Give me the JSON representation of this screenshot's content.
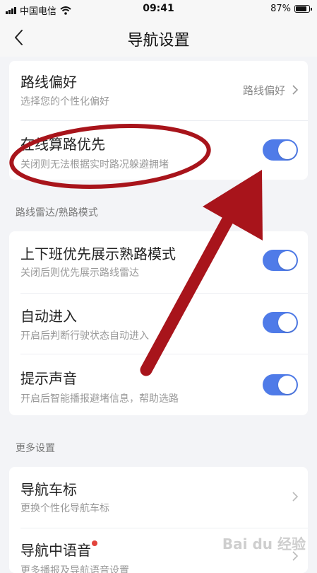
{
  "status_bar": {
    "carrier": "中国电信",
    "time": "09:41",
    "battery": "87%",
    "battery_level": 0.87
  },
  "nav": {
    "title": "导航设置"
  },
  "route_pref": {
    "title": "路线偏好",
    "subtitle": "选择您的个性化偏好",
    "value": "路线偏好"
  },
  "online_calc": {
    "title": "在线算路优先",
    "subtitle": "关闭则无法根据实时路况躲避拥堵",
    "enabled": true
  },
  "section_radar": {
    "label": "路线雷达/熟路模式"
  },
  "commute_mode": {
    "title": "上下班优先展示熟路模式",
    "subtitle": "关闭后则优先展示路线雷达",
    "enabled": true
  },
  "auto_enter": {
    "title": "自动进入",
    "subtitle": "开启后判断行驶状态自动进入",
    "enabled": true
  },
  "alert_sound": {
    "title": "提示声音",
    "subtitle": "开启后智能播报避堵信息，帮助选路",
    "enabled": true
  },
  "section_more": {
    "label": "更多设置"
  },
  "car_icon": {
    "title": "导航车标",
    "subtitle": "更换个性化导航车标"
  },
  "voice": {
    "title": "导航中语音",
    "subtitle": "更多播报及导航语音设置"
  },
  "watermark": "Bai du 经验",
  "colors": {
    "accent": "#4f7be8",
    "annotation": "#a8141b",
    "badge": "#e2433c",
    "background": "#f3f4f7"
  }
}
